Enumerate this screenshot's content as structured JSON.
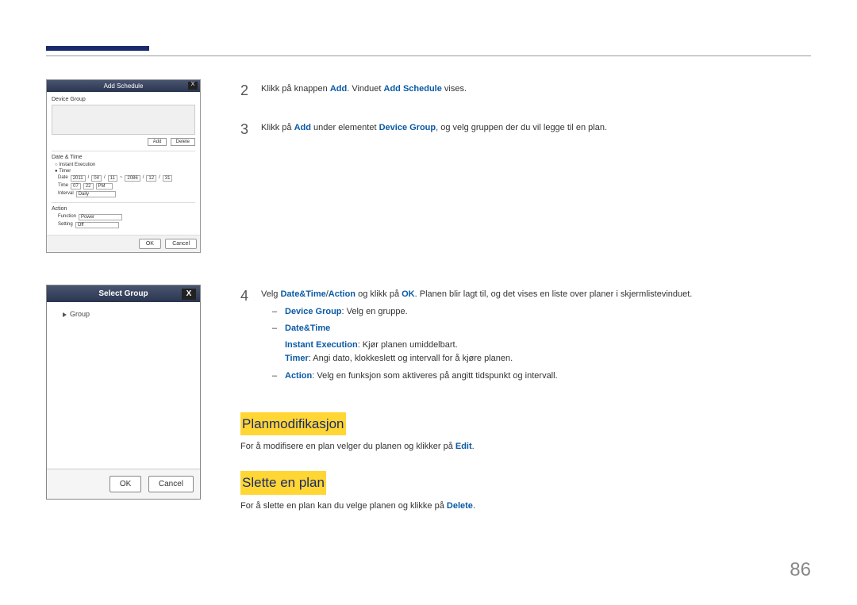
{
  "dialog1": {
    "title": "Add Schedule",
    "close": "X",
    "device_group_label": "Device Group",
    "add_btn": "Add",
    "delete_btn": "Delete",
    "datetime_label": "Date & Time",
    "instant_exec": "Instant Execution",
    "timer": "Timer",
    "date_label": "Date",
    "date_y1": "2011",
    "date_m1": "04",
    "date_d1": "11",
    "date_sep": "~",
    "date_y2": "2086",
    "date_m2": "12",
    "date_d2": "31",
    "time_label": "Time",
    "time_h": "07",
    "time_m": "22",
    "time_ampm": "PM",
    "interval_label": "Interval",
    "interval_val": "Daily",
    "action_label": "Action",
    "function_label": "Function",
    "function_val": "Power",
    "setting_label": "Setting",
    "setting_val": "Off",
    "ok": "OK",
    "cancel": "Cancel"
  },
  "step2": {
    "num": "2",
    "t1": "Klikk på knappen ",
    "b1": "Add",
    "t2": ". Vinduet ",
    "b2": "Add Schedule",
    "t3": " vises."
  },
  "step3": {
    "num": "3",
    "t1": "Klikk på ",
    "b1": "Add",
    "t2": " under elementet ",
    "b2": "Device Group",
    "t3": ", og velg gruppen der du vil legge til en plan."
  },
  "dialog2": {
    "title": "Select Group",
    "close": "X",
    "tree_root": "Group",
    "ok": "OK",
    "cancel": "Cancel"
  },
  "step4": {
    "num": "4",
    "t1": "Velg ",
    "b1": "Date&Time",
    "sep1": "/",
    "b2": "Action",
    "t2": " og klikk på ",
    "b3": "OK",
    "t3": ". Planen blir lagt til, og det vises en liste over planer i skjermlistevinduet.",
    "item1_b": "Device Group",
    "item1_t": ": Velg en gruppe.",
    "item2_b": "Date&Time",
    "item2a_b": "Instant Execution",
    "item2a_t": ": Kjør planen umiddelbart.",
    "item2b_b": "Timer",
    "item2b_t": ": Angi dato, klokkeslett og intervall for å kjøre planen.",
    "item3_b": "Action",
    "item3_t": ": Velg en funksjon som aktiveres på angitt tidspunkt og intervall."
  },
  "heading1": "Planmodifikasjon",
  "para1": {
    "t1": "For å modifisere en plan velger du planen og klikker på ",
    "b1": "Edit",
    "t2": "."
  },
  "heading2": "Slette en plan",
  "para2": {
    "t1": "For å slette en plan kan du velge planen og klikke på ",
    "b1": "Delete",
    "t2": "."
  },
  "page_number": "86"
}
